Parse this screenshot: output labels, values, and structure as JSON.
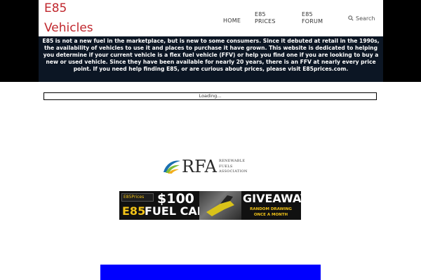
{
  "header": {
    "logo_line1": "E85",
    "logo_line2": "Vehicles"
  },
  "nav": {
    "home": "HOME",
    "prices_line1": "E85",
    "prices_line2": "PRICES",
    "forum_line1": "E85",
    "forum_line2": "FORUM",
    "search_label": "Search"
  },
  "banner": {
    "text": "E85 is not a new fuel in the marketplace, but is new to some consumers. Since it debuted at retail in the 1990s, the availability of vehicles to use it and places to purchase it have grown. This website is dedicated to helping you determine if your current vehicle is a flex fuel vehicle (FFV) or help you find one if you are looking to buy a new or used vehicle. Since they have been available for nearly 20 years, there is an FFV at nearly every price point. If you need help finding E85, or are curious about prices, please visit E85prices.com."
  },
  "loading": {
    "text": "Loading..."
  },
  "rfa_logo": {
    "abbr": "RFA",
    "line1": "RENEWABLE",
    "line2": "FUELS",
    "line3": "ASSOCIATION"
  },
  "ad": {
    "brand": "E85Prices",
    "amount": "$100",
    "e85": "E85",
    "card": "FUEL CARD",
    "giveaway": "GIVEAWAY",
    "drawing_line1": "RANDOM DRAWING",
    "drawing_line2": "ONCE A MONTH"
  },
  "colors": {
    "logo_red": "#c0272d",
    "banner_bg": "#0c1624",
    "ad_yellow": "#f2c318",
    "blue_block": "#0000ff"
  }
}
